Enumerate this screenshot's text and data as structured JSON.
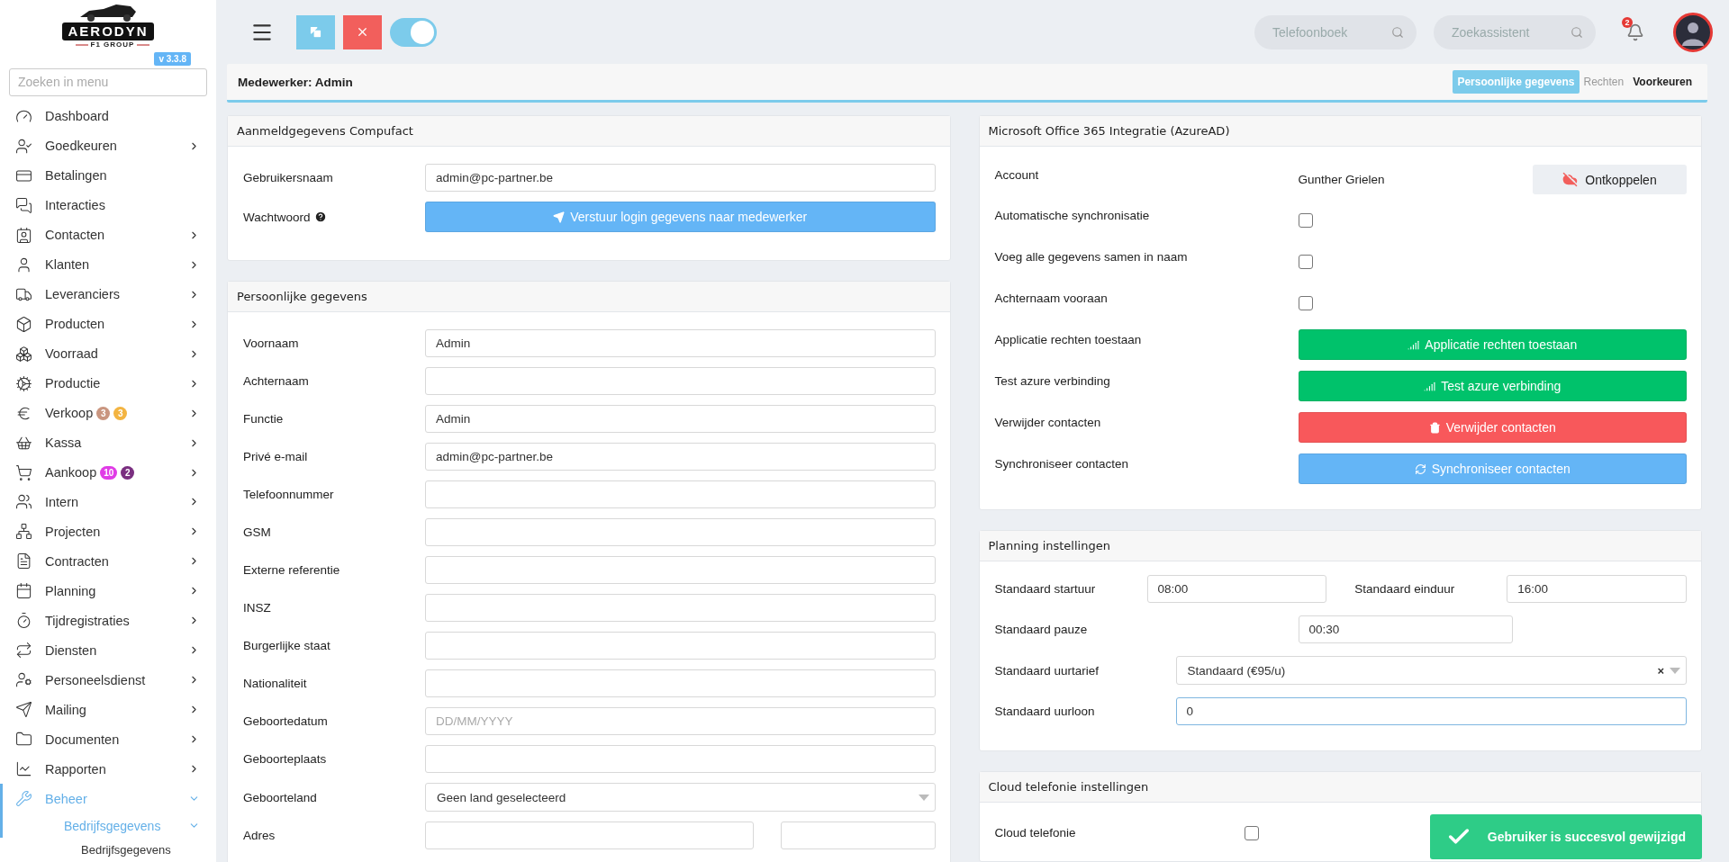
{
  "sidebar": {
    "logo": {
      "name": "AERODYN",
      "sub": "F1 GROUP"
    },
    "version": "v 3.3.8",
    "search": {
      "placeholder": "Zoeken in menu"
    },
    "items": [
      {
        "label": "Dashboard",
        "has_children": false,
        "expanded": false,
        "selected": false
      },
      {
        "label": "Goedkeuren",
        "has_children": true,
        "expanded": false,
        "selected": false
      },
      {
        "label": "Betalingen",
        "has_children": false,
        "expanded": false,
        "selected": false
      },
      {
        "label": "Interacties",
        "has_children": false,
        "expanded": false,
        "selected": false
      },
      {
        "label": "Contacten",
        "has_children": true,
        "expanded": false,
        "selected": false
      },
      {
        "label": "Klanten",
        "has_children": true,
        "expanded": false,
        "selected": false
      },
      {
        "label": "Leveranciers",
        "has_children": true,
        "expanded": false,
        "selected": false
      },
      {
        "label": "Producten",
        "has_children": true,
        "expanded": false,
        "selected": false
      },
      {
        "label": "Voorraad",
        "has_children": true,
        "expanded": false,
        "selected": false
      },
      {
        "label": "Productie",
        "has_children": true,
        "expanded": false,
        "selected": false
      },
      {
        "label": "Verkoop",
        "has_children": true,
        "expanded": false,
        "selected": false,
        "badges": [
          {
            "text": "3",
            "color": "#c9957f"
          },
          {
            "text": "3",
            "color": "#f3b441"
          }
        ]
      },
      {
        "label": "Kassa",
        "has_children": true,
        "expanded": false,
        "selected": false
      },
      {
        "label": "Aankoop",
        "has_children": true,
        "expanded": false,
        "selected": false,
        "badges": [
          {
            "text": "10",
            "color": "#e03ce6"
          },
          {
            "text": "2",
            "color": "#7a2f80"
          }
        ]
      },
      {
        "label": "Intern",
        "has_children": true,
        "expanded": false,
        "selected": false
      },
      {
        "label": "Projecten",
        "has_children": true,
        "expanded": false,
        "selected": false
      },
      {
        "label": "Contracten",
        "has_children": true,
        "expanded": false,
        "selected": false
      },
      {
        "label": "Planning",
        "has_children": true,
        "expanded": false,
        "selected": false
      },
      {
        "label": "Tijdregistraties",
        "has_children": true,
        "expanded": false,
        "selected": false
      },
      {
        "label": "Diensten",
        "has_children": true,
        "expanded": false,
        "selected": false
      },
      {
        "label": "Personeelsdienst",
        "has_children": true,
        "expanded": false,
        "selected": false
      },
      {
        "label": "Mailing",
        "has_children": true,
        "expanded": false,
        "selected": false
      },
      {
        "label": "Documenten",
        "has_children": true,
        "expanded": false,
        "selected": false
      },
      {
        "label": "Rapporten",
        "has_children": true,
        "expanded": false,
        "selected": false
      },
      {
        "label": "Beheer",
        "has_children": true,
        "expanded": true,
        "selected": true,
        "children": [
          {
            "label": "Bedrijfsgegevens",
            "expanded": true,
            "children": [
              {
                "label": "Bedrijfsgegevens"
              }
            ]
          }
        ]
      }
    ]
  },
  "topbar": {
    "toggle": {
      "on": true
    },
    "searches": [
      {
        "placeholder": "Telefoonboek"
      },
      {
        "placeholder": "Zoekassistent"
      }
    ],
    "notifications": {
      "count": "2"
    }
  },
  "header": {
    "title": "Medewerker: Admin",
    "tabs": [
      {
        "label": "Persoonlijke gegevens",
        "selected": true,
        "disabled": false
      },
      {
        "label": "Rechten",
        "selected": false,
        "disabled": true
      },
      {
        "label": "Voorkeuren",
        "selected": false,
        "disabled": false
      }
    ]
  },
  "left_cards": [
    {
      "title": "Aanmeldgegevens Compufact",
      "rows": [
        {
          "kind": "input",
          "label": "Gebruikersnaam",
          "value": "admin@pc-partner.be"
        },
        {
          "kind": "send",
          "label": "Wachtwoord",
          "button": "Verstuur login gegevens naar medewerker"
        }
      ]
    },
    {
      "title": "Persoonlijke gegevens",
      "rows": [
        {
          "kind": "input",
          "label": "Voornaam",
          "value": "Admin"
        },
        {
          "kind": "input",
          "label": "Achternaam"
        },
        {
          "kind": "input",
          "label": "Functie",
          "value": "Admin"
        },
        {
          "kind": "input",
          "label": "Privé e-mail",
          "value": "admin@pc-partner.be"
        },
        {
          "kind": "input",
          "label": "Telefoonnummer"
        },
        {
          "kind": "input",
          "label": "GSM"
        },
        {
          "kind": "input",
          "label": "Externe referentie"
        },
        {
          "kind": "input",
          "label": "INSZ"
        },
        {
          "kind": "input",
          "label": "Burgerlijke staat"
        },
        {
          "kind": "input",
          "label": "Nationaliteit"
        },
        {
          "kind": "input",
          "label": "Geboortedatum",
          "placeholder": "DD/MM/YYYY"
        },
        {
          "kind": "input",
          "label": "Geboorteplaats"
        },
        {
          "kind": "select",
          "label": "Geboorteland",
          "value": "Geen land geselecteerd"
        },
        {
          "kind": "pair",
          "label": "Adres"
        }
      ]
    }
  ],
  "azure": {
    "title": "Microsoft Office 365 Integratie (AzureAD)",
    "rows": [
      {
        "kind": "account",
        "label": "Account",
        "value": "Gunther Grielen",
        "button": "Ontkoppelen"
      },
      {
        "kind": "checkbox",
        "label": "Automatische synchronisatie",
        "checked": false
      },
      {
        "kind": "checkbox",
        "label": "Voeg alle gegevens samen in naam",
        "checked": false
      },
      {
        "kind": "checkbox",
        "label": "Achternaam vooraan",
        "checked": false
      },
      {
        "kind": "success",
        "label": "Applicatie rechten toestaan",
        "button": "Applicatie rechten toestaan"
      },
      {
        "kind": "success",
        "label": "Test azure verbinding",
        "button": "Test azure verbinding"
      },
      {
        "kind": "danger",
        "label": "Verwijder contacten",
        "button": "Verwijder contacten"
      },
      {
        "kind": "info",
        "label": "Synchroniseer contacten",
        "button": "Synchroniseer contacten"
      }
    ]
  },
  "planning": {
    "title": "Planning instellingen",
    "rows": [
      {
        "kind": "pair",
        "fields": [
          {
            "label": "Standaard startuur",
            "value": "08:00"
          },
          {
            "label": "Standaard einduur",
            "value": "16:00"
          }
        ]
      },
      {
        "kind": "short",
        "label": "Standaard pauze",
        "value": "00:30",
        "focused": false
      },
      {
        "kind": "select",
        "label": "Standaard uurtarief",
        "value": "Standaard (€95/u)",
        "clear": "×"
      },
      {
        "kind": "wide",
        "label": "Standaard uurloon",
        "value": "0",
        "focused": true
      }
    ]
  },
  "cloud": {
    "title": "Cloud telefonie instellingen",
    "rows": [
      {
        "kind": "checkbox",
        "label": "Cloud telefonie",
        "checked": false
      }
    ]
  },
  "toast": {
    "text": "Gebruiker is succesvol gewijzigd"
  }
}
